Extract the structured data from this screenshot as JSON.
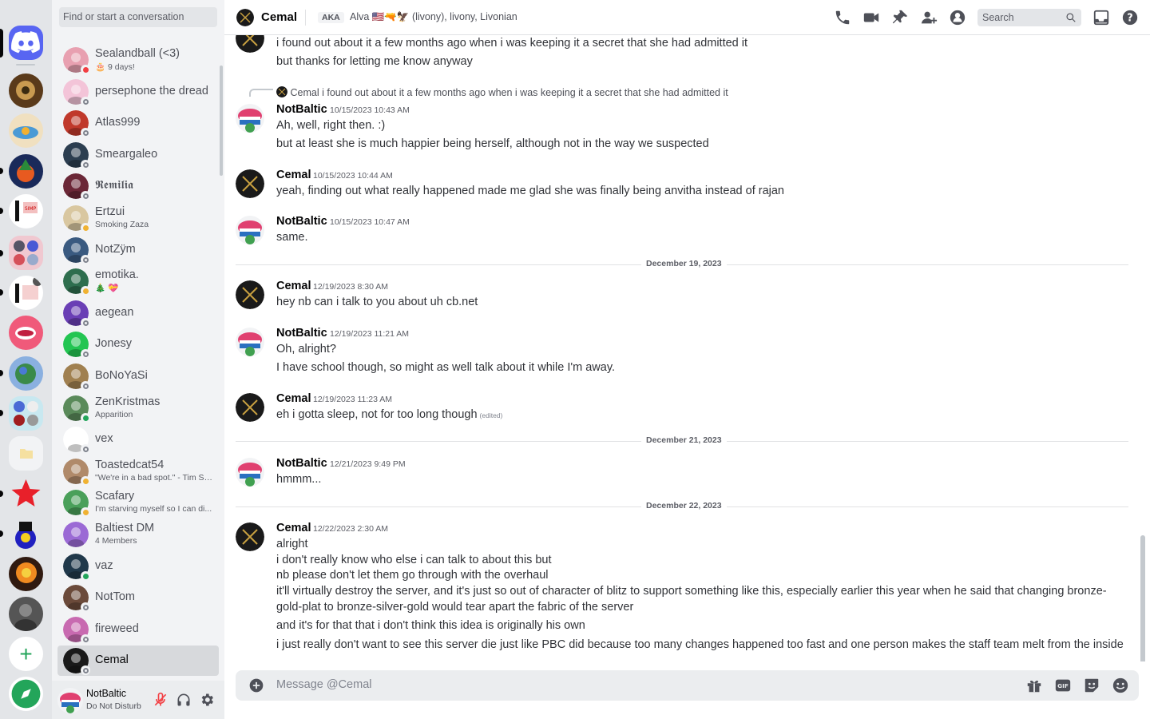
{
  "sidebar": {
    "search_placeholder": "Find or start a conversation",
    "dms": [
      {
        "name": "Sealandball (<3)",
        "sub": "🎂 9 days!",
        "color": "#e8a0b0",
        "status": "dnd"
      },
      {
        "name": "persephone the dread",
        "sub": "",
        "color": "#f3c4d8",
        "status": "offline"
      },
      {
        "name": "Atlas999",
        "sub": "",
        "color": "#c0392b",
        "status": "offline"
      },
      {
        "name": "Smeargaleo",
        "sub": "",
        "color": "#2c3e50",
        "status": "offline"
      },
      {
        "name": "𝕽𝖊𝖒𝖎𝖑𝖎𝖆",
        "sub": "",
        "color": "#6b2737",
        "status": "offline"
      },
      {
        "name": "Ertzui",
        "sub": "Smoking Zaza",
        "color": "#d9c7a0",
        "status": "idle"
      },
      {
        "name": "NotZÿm",
        "sub": "",
        "color": "#3a5a80",
        "status": "offline"
      },
      {
        "name": "emotika.",
        "sub": "🎄 💝",
        "color": "#2e6e4e",
        "status": "idle"
      },
      {
        "name": "aegean",
        "sub": "",
        "color": "#6a3fb5",
        "status": "offline"
      },
      {
        "name": "Jonesy",
        "sub": "",
        "color": "#23c552",
        "status": "offline"
      },
      {
        "name": "BoNoYaSi",
        "sub": "",
        "color": "#a08050",
        "status": "offline"
      },
      {
        "name": "ZenKristmas",
        "sub": "Apparition",
        "color": "#5a8a5a",
        "status": "online"
      },
      {
        "name": "vex",
        "sub": "",
        "color": "#ffffff",
        "status": "offline"
      },
      {
        "name": "Toastedcat54",
        "sub": "\"We're in a bad spot.\" - Tim Sa...",
        "color": "#b08a6a",
        "status": "idle"
      },
      {
        "name": "Scafary",
        "sub": "I'm starving myself so I can di...",
        "color": "#4aa05a",
        "status": "idle"
      },
      {
        "name": "Baltiest DM",
        "sub": "4 Members",
        "color": "#9b6ad5",
        "status": "none"
      },
      {
        "name": "vaz",
        "sub": "",
        "color": "#20384a",
        "status": "online"
      },
      {
        "name": "NotTom",
        "sub": "",
        "color": "#6b4a3a",
        "status": "offline"
      },
      {
        "name": "fireweed",
        "sub": "",
        "color": "#c86ab0",
        "status": "offline"
      },
      {
        "name": "Cemal",
        "sub": "",
        "color": "#1a1a1a",
        "status": "offline"
      }
    ]
  },
  "user_panel": {
    "name": "NotBaltic",
    "status": "Do Not Disturb"
  },
  "header": {
    "name": "Cemal",
    "aka": "AKA",
    "aliases": "Alva 🇺🇸🔫🦅 (livony), livony, Livonian",
    "search_placeholder": "Search"
  },
  "reply": {
    "author": "Cemal",
    "text": "i found out about it a few months ago when i was keeping it a secret that she had admitted it"
  },
  "messages": {
    "m0": {
      "lines": [
        "i found out about it a few months ago when i was keeping it a secret that she had admitted it",
        "but thanks for letting me know anyway"
      ]
    },
    "m1": {
      "author": "NotBaltic",
      "timestamp": "10/15/2023 10:43 AM",
      "lines": [
        "Ah, well, right then. :)",
        "but at least she is much happier being herself, although not in the way we suspected"
      ]
    },
    "m2": {
      "author": "Cemal",
      "timestamp": "10/15/2023 10:44 AM",
      "lines": [
        "yeah, finding out what really happened made me glad she was finally being anvitha instead of rajan"
      ]
    },
    "m3": {
      "author": "NotBaltic",
      "timestamp": "10/15/2023 10:47 AM",
      "lines": [
        "same."
      ]
    },
    "d1": "December 19, 2023",
    "m4": {
      "author": "Cemal",
      "timestamp": "12/19/2023 8:30 AM",
      "lines": [
        "hey nb can i talk to you about uh cb.net"
      ]
    },
    "m5": {
      "author": "NotBaltic",
      "timestamp": "12/19/2023 11:21 AM",
      "lines": [
        "Oh, alright?",
        "I have school though, so might as well talk about it while I'm away."
      ]
    },
    "m6": {
      "author": "Cemal",
      "timestamp": "12/19/2023 11:23 AM",
      "lines": [
        "eh i gotta sleep, not for too long though"
      ],
      "edited": "(edited)"
    },
    "d2": "December 21, 2023",
    "m7": {
      "author": "NotBaltic",
      "timestamp": "12/21/2023 9:49 PM",
      "lines": [
        "hmmm..."
      ]
    },
    "d3": "December 22, 2023",
    "m8": {
      "author": "Cemal",
      "timestamp": "12/22/2023 2:30 AM",
      "lines": [
        "alright",
        "i don't really know who else i can talk to about this but",
        "nb please don't let them go through with the overhaul",
        "it'll virtually destroy the server, and it's just so out of character of blitz to support something like this, especially earlier this year when he said that changing bronze-",
        "gold-plat to bronze-silver-gold would tear apart the fabric of the server",
        "and it's for that that i don't think this idea is originally his own",
        "i just really don't want to see this server die just like PBC did because too many changes happened too fast and one person makes the staff team melt from the inside"
      ]
    }
  },
  "composer": {
    "placeholder": "Message @Cemal"
  },
  "colors": {
    "brand": "#5865f2",
    "online": "#23a55a",
    "idle": "#f0b232",
    "dnd": "#f23f43"
  }
}
